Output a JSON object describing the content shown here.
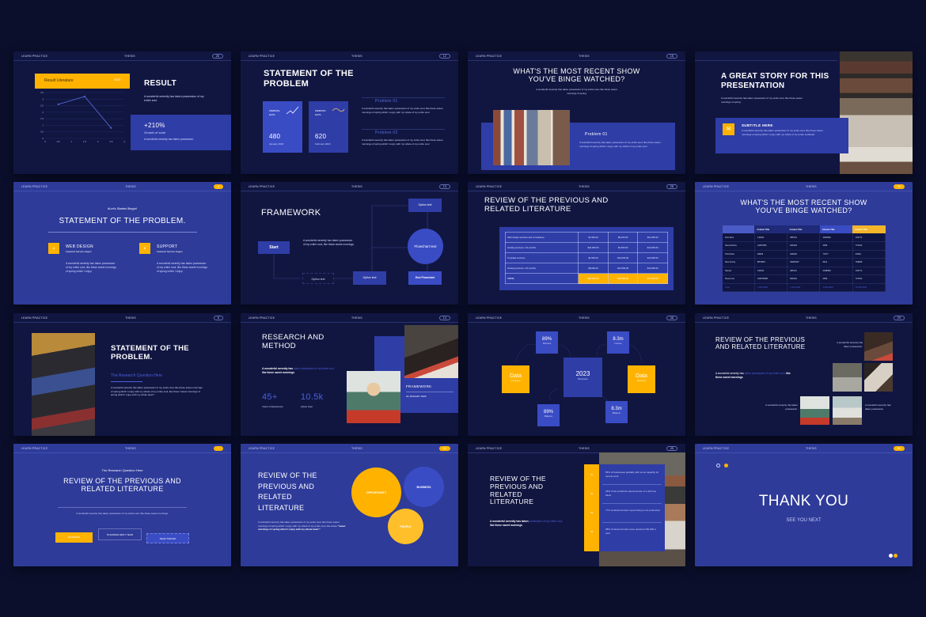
{
  "common": {
    "brand": "LEARN PRACTICE",
    "center": "THESIS"
  },
  "colors": {
    "background": "#0b0f2c",
    "dark_slide": "#111641",
    "blue_slide": "#2e3b99",
    "accent_yellow": "#ffb300",
    "accent_blue": "#3a4cc4"
  },
  "s1": {
    "page": "26",
    "card_title": "Result Literature",
    "card_tag": "2023",
    "title": "RESULT",
    "desc": "A wonderful serenity has taken possession of my entire soul.",
    "stat": "+210%",
    "stat_label": "Growth of solar",
    "stat_desc": "A wonderful serenity has taken possession",
    "chart_data": {
      "type": "line",
      "title": "Result Literature",
      "x_ticks": [
        "0",
        "0.5",
        "1",
        "1.5",
        "2",
        "2.5",
        "3"
      ],
      "y_ticks": [
        "0",
        "0.5",
        "1",
        "1.5",
        "2",
        "2.5",
        "3",
        "3.5"
      ],
      "points": [
        [
          0.5,
          2.6
        ],
        [
          1.5,
          3.2
        ],
        [
          2.5,
          0.8
        ]
      ],
      "ylim": [
        0,
        3.5
      ],
      "xlim": [
        0,
        3
      ],
      "grid": true
    }
  },
  "s2": {
    "page": "12",
    "title": "STATEMENT OF THE PROBLEM",
    "cards": [
      {
        "label": "WEBSITE DATA",
        "value": "480",
        "date": "January 2023"
      },
      {
        "label": "WEBSITE DATA",
        "value": "620",
        "date": "February 2023"
      }
    ],
    "problems": [
      {
        "title": "Problem 01",
        "desc": "A wonderful serenity has taken possession of my entire soul, like these sweet mornings of spring which I enjoy with my whole of my entire soul"
      },
      {
        "title": "Problem 02",
        "desc": "A wonderful serenity has taken possession of my entire soul, like these sweet mornings of spring which I enjoy with my whole of my entire soul"
      }
    ]
  },
  "s3": {
    "page": "15",
    "title": "WHAT'S THE MOST RECENT SHOW YOU'VE BINGE WATCHED?",
    "desc": "A wonderful serenity has taken possession of my entire soul, like these sweet mornings of spring",
    "problem_title": "Problem 01",
    "problem_desc": "A wonderful serenity has taken possession of my entire soul, like these sweet mornings of spring which I enjoy with my whole of my entire soul"
  },
  "s4": {
    "title": "A GREAT STORY FOR THIS PRESENTATION",
    "desc": "A wonderful serenity has taken possession of my entire soul, like these sweet mornings of spring.",
    "subtitle": "SUBTITLE HERE",
    "sub_desc": "A wonderful serenity has taken possession of my entire soul, like these sweet mornings of spring which I enjoy with my whole of my entire soulheart."
  },
  "s5": {
    "page": "4",
    "kicker": "#Let's Started Begin!",
    "title": "STATEMENT OF THE PROBLEM.",
    "items": [
      {
        "icon": "A",
        "title": "WEB DESIGN",
        "sub": "Featured Service slogan",
        "desc": "A wonderful serenity has taken possession of my entire soul, like these sweet mornings of spring which I enjoy."
      },
      {
        "icon": "B",
        "title": "SUPPORT",
        "sub": "Featured Service slogan",
        "desc": "A wonderful serenity has taken possession of my entire soul, like these sweet mornings of spring which I enjoy."
      }
    ]
  },
  "s6": {
    "page": "13",
    "title": "FRAMEWORK",
    "start": "Start",
    "desc": "A wonderful serenity has taken possession of my entire soul, like these sweet mornings",
    "opt1": "Option text",
    "opt2": "Option text",
    "opt3": "Option text",
    "circle": "Flowchart text",
    "end": "End Flowchart"
  },
  "s7": {
    "page": "28",
    "title": "REVIEW OF THE PREVIOUS AND RELATED LITERATURE",
    "rows": [
      [
        "Web design services and consultancy",
        "$1,500.00",
        "$8,200.00",
        "$21,650.00"
      ],
      [
        "Hosting services / 24 months",
        "$20,000.00",
        "$2,000.00",
        "$10,000.00"
      ],
      [
        "Template services",
        "$1,500.00",
        "$10,000.00",
        "$10,000.00"
      ],
      [
        "Hosting services / 24 months",
        "$8,000.00",
        "$12,500.00",
        "$10,000.00"
      ]
    ],
    "total": [
      "TOTAL",
      "$30,000.00",
      "$38,500.00",
      "$71,650.00"
    ]
  },
  "s8": {
    "page": "30",
    "title": "WHAT'S THE MOST RECENT SHOW YOU'VE BINGE WATCHED?",
    "headers": [
      "",
      "Column Title",
      "Column Title",
      "Column Title",
      "Column Title"
    ],
    "rows": [
      [
        "First Row",
        "135101",
        "385101",
        "2394599",
        "132771"
      ],
      [
        "Second Row",
        "12837836",
        "636493",
        "4099",
        "737913"
      ],
      [
        "Third Row",
        "48849",
        "649003",
        "71577",
        "34591"
      ],
      [
        "Row Fourty",
        "8873897",
        "36905467",
        "6641",
        "799835"
      ],
      [
        "Names",
        "135101",
        "385101",
        "2348998",
        "132771"
      ],
      [
        "Rows Line",
        "128378389",
        "826491",
        "4099",
        "737912"
      ],
      [
        "Total",
        "1,000.0000",
        "1,000.0000",
        "1,000.0000",
        "10,000.0000"
      ]
    ]
  },
  "s9": {
    "page": "8",
    "title": "STATEMENT OF THE PROBLEM.",
    "question": "The Research Question Here",
    "desc": "A wonderful serenity has taken possession of my entire soul, like these sweet mornings of spring which I enjoy with my whole of my entire soul, like these \"sweet mornings of spring which I enjoy with my whole heart.\""
  },
  "s10": {
    "page": "14",
    "title": "RESEARCH AND METHOD",
    "desc_a": "A wonderful serenity has",
    "desc_link": "taken possession of my entire soul,",
    "desc_b": "like these sweet mornings",
    "stats": [
      {
        "value": "45+",
        "label": "Years of Experience"
      },
      {
        "value": "10.5k",
        "label": "Active User"
      }
    ],
    "card_title": "FRAMEWORK",
    "card_date": "22 JANUARY 2023"
  },
  "s11": {
    "page": "46",
    "center_value": "2023",
    "center_label": "Business",
    "nodes": [
      {
        "value": "89%",
        "label": "Partners"
      },
      {
        "value": "8.3m",
        "label": "Income"
      },
      {
        "value": "Data",
        "label": "Company"
      },
      {
        "value": "Data",
        "label": "Business"
      },
      {
        "value": "89%",
        "label": "Balance"
      },
      {
        "value": "8.3m",
        "label": "Balance"
      }
    ]
  },
  "s12": {
    "page": "29",
    "title": "REVIEW OF THE PREVIOUS AND RELATED LITERATURE",
    "desc_a": "A wonderful serenity has",
    "desc_link": "taken possession of my entire soul,",
    "desc_b": "like these sweet mornings",
    "cap1": "A wonderful serenity has taken possession.",
    "cap2": "A wonderful serenity has taken possession.",
    "cap3": "A wonderful serenity has taken possession."
  },
  "s13": {
    "page": "7",
    "kicker": "The Research Question Here",
    "title": "REVIEW OF THE PREVIOUS AND RELATED LITERATURE",
    "desc": "A wonderful serenity has taken possession of my entire soul, like these sweet mornings.",
    "buttons": [
      "BUSINESS",
      "PLANNING NEXT YEAR",
      "TEAM TARGET"
    ]
  },
  "s14": {
    "page": "32",
    "title": "REVIEW OF THE PREVIOUS AND RELATED LITERATURE",
    "desc": "A wonderful serenity has taken possession of my entire soul, like these sweet mornings of spring which I enjoy with my whole of my entire soul, like these",
    "desc_bold": "\"sweet mornings of spring which I enjoy with my whole heart.\"",
    "circles": [
      "OPPORTUNITY",
      "BUSINESS",
      "PEOPLE"
    ]
  },
  "s15": {
    "page": "45",
    "title": "REVIEW OF THE PREVIOUS AND RELATED LITERATURE",
    "desc_a": "A wonderful serenity has taken",
    "desc_link": "possession of my entire soul,",
    "desc_b": "like these sweet mornings",
    "items": [
      {
        "n": "01",
        "text": "55% of businesses globally offer some capacity for remote work"
      },
      {
        "n": "02",
        "text": "18% of the workforce telecommute on a full time basis"
      },
      {
        "n": "03",
        "text": "77% of telecommuters report being more productive"
      },
      {
        "n": "04",
        "text": "38% of telecommuters save upward of $2,000 a year"
      }
    ]
  },
  "s16": {
    "page": "50",
    "title": "THANK YOU",
    "subtitle": "SEE YOU NEXT"
  }
}
